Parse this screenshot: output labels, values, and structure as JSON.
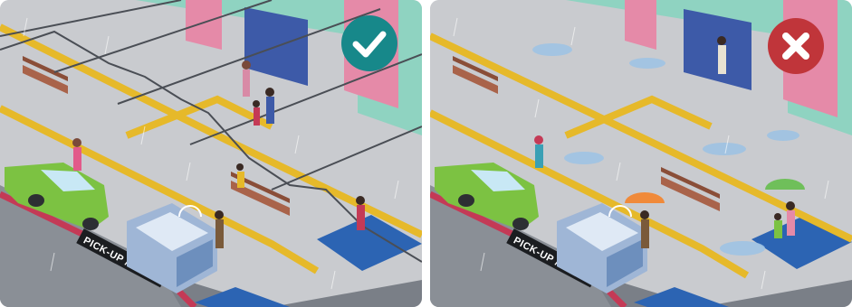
{
  "panels": [
    {
      "id": "sheltered",
      "verdict": "correct",
      "verdict_color": "#17888a",
      "verdict_icon": "checkmark-icon",
      "road_marking": "PICK-UP / DROP-OFF"
    },
    {
      "id": "unsheltered",
      "verdict": "incorrect",
      "verdict_color": "#c0353a",
      "verdict_icon": "cross-icon",
      "road_marking": "PICK-UP / DROP-OFF"
    }
  ],
  "colors": {
    "pavement": "#c9cbcf",
    "tactile_paving": "#e6b92a",
    "accessible_bay": "#2c64b3",
    "curb_red": "#c43a56",
    "car": "#7cc242",
    "shuttle": "#9fb6d6",
    "building_pink": "#e58aa8",
    "building_mint": "#8fd3c1"
  }
}
